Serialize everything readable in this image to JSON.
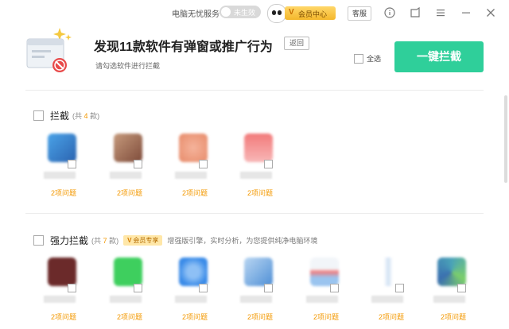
{
  "topbar": {
    "service_label": "电脑无忧服务",
    "toggle_text": "未生效",
    "vip_badge": "V",
    "vip_center": "会员中心",
    "support": "客服"
  },
  "header": {
    "title": "发现11款软件有弹窗或推广行为",
    "back": "返回",
    "subtitle": "请勾选软件进行拦截",
    "select_all": "全选",
    "block_all": "一键拦截"
  },
  "sections": [
    {
      "name": "拦截",
      "count_prefix": "(共",
      "count": "4",
      "count_suffix": "款)",
      "apps": [
        {
          "issue": "2项问题",
          "color": "#3b82c8"
        },
        {
          "issue": "2项问题",
          "color": "#b4816e"
        },
        {
          "issue": "2项问题",
          "color": "#f0a58a"
        },
        {
          "issue": "2项问题",
          "color": "#f07a7a"
        }
      ]
    },
    {
      "name": "强力拦截",
      "count_prefix": "(共",
      "count": "7",
      "count_suffix": "款)",
      "vip_tag_v": "V",
      "vip_tag": "会员专享",
      "desc": "增强版引擎，实时分析，为您提供纯净电脑环境",
      "apps": [
        {
          "issue": "2项问题",
          "color": "#6b2a2a"
        },
        {
          "issue": "2项问题",
          "color": "#3ecf5e"
        },
        {
          "issue": "2项问题",
          "color": "#3a8be8"
        },
        {
          "issue": "2项问题",
          "color": "#6aa6e0"
        },
        {
          "issue": "2项问题",
          "color": "#e8eef5"
        },
        {
          "issue": "2项问题",
          "color": "#cfe0f3"
        },
        {
          "issue": "2项问题",
          "color": "#4aa3b8"
        }
      ]
    }
  ],
  "colors": {
    "accent": "#2fcf9a",
    "warning": "#f39800"
  }
}
